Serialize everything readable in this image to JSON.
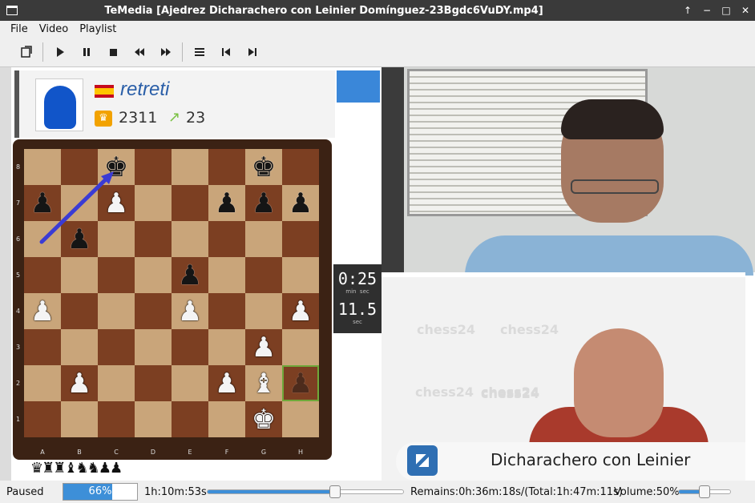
{
  "window": {
    "title": "TeMedia [Ajedrez Dicharachero con Leinier Domínguez-23Bgdc6VuDY.mp4]"
  },
  "menu": [
    "File",
    "Video",
    "Playlist"
  ],
  "toolbar": {
    "buttons": [
      "open-file-icon",
      "play-icon",
      "pause-icon",
      "stop-icon",
      "rewind-icon",
      "fast-forward-icon",
      "playlist-icon",
      "previous-icon",
      "next-icon"
    ]
  },
  "video": {
    "player": {
      "name": "retreti",
      "rating": "2311",
      "rating_change": "23",
      "flag": "Spain"
    },
    "board": {
      "ranks": [
        "8",
        "7",
        "6",
        "5",
        "4",
        "3",
        "2",
        "1"
      ],
      "files": [
        "A",
        "B",
        "C",
        "D",
        "E",
        "F",
        "G",
        "H"
      ],
      "pieces": [
        {
          "square": "c8",
          "glyph": "♚",
          "color": "black",
          "name": "bishop"
        },
        {
          "square": "g8",
          "glyph": "♚",
          "color": "black",
          "name": "king"
        },
        {
          "square": "a7",
          "glyph": "♟",
          "color": "black",
          "name": "pawn"
        },
        {
          "square": "c7",
          "glyph": "♟",
          "color": "white",
          "name": "pawn"
        },
        {
          "square": "f7",
          "glyph": "♟",
          "color": "black",
          "name": "pawn"
        },
        {
          "square": "g7",
          "glyph": "♟",
          "color": "black",
          "name": "pawn"
        },
        {
          "square": "h7",
          "glyph": "♟",
          "color": "black",
          "name": "pawn"
        },
        {
          "square": "b6",
          "glyph": "♟",
          "color": "black",
          "name": "pawn"
        },
        {
          "square": "e5",
          "glyph": "♟",
          "color": "black",
          "name": "pawn"
        },
        {
          "square": "a4",
          "glyph": "♟",
          "color": "white",
          "name": "pawn"
        },
        {
          "square": "e4",
          "glyph": "♟",
          "color": "white",
          "name": "pawn"
        },
        {
          "square": "h4",
          "glyph": "♟",
          "color": "white",
          "name": "pawn"
        },
        {
          "square": "g3",
          "glyph": "♟",
          "color": "white",
          "name": "pawn"
        },
        {
          "square": "b2",
          "glyph": "♟",
          "color": "white",
          "name": "pawn"
        },
        {
          "square": "f2",
          "glyph": "♟",
          "color": "white",
          "name": "pawn"
        },
        {
          "square": "g2",
          "glyph": "♝",
          "color": "white",
          "name": "bishop"
        },
        {
          "square": "h2",
          "glyph": "♟",
          "color": "black",
          "name": "pawn-ghost"
        },
        {
          "square": "g1",
          "glyph": "♚",
          "color": "white",
          "name": "king"
        }
      ],
      "captured": "♛♜♜♝♞♞♟♟"
    },
    "clock": {
      "time": "0:25",
      "min_label": "min",
      "sec_label": "sec",
      "increment": "11.5",
      "inc_label": "sec"
    },
    "watermark": "chess24",
    "banner": "Dicharachero con Leinier"
  },
  "status": {
    "state": "Paused",
    "buffer_percent": 66,
    "buffer_text": "66%",
    "elapsed": "1h:10m:53s",
    "position_fraction": 0.65,
    "remains": "Remains:0h:36m:18s/(Total:1h:47m:11s)",
    "volume_text": "Volume:50%",
    "volume_fraction": 0.5
  },
  "colors": {
    "accent": "#3d8fd8",
    "titlebar": "#3a3a3a"
  }
}
